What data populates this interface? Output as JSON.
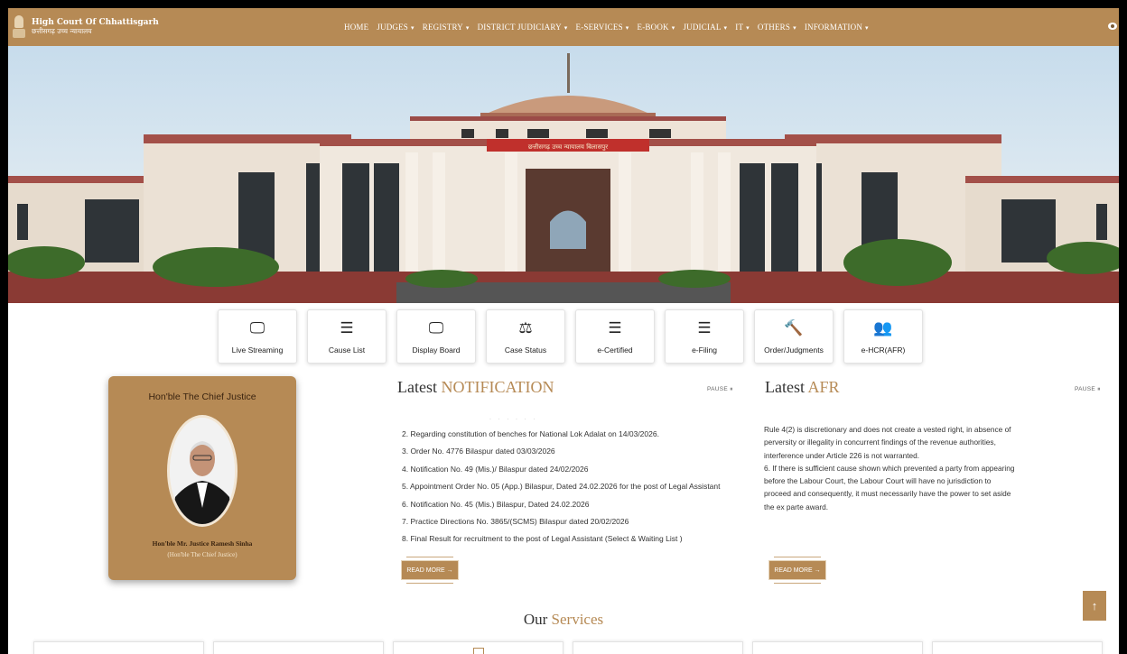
{
  "header": {
    "brand_title": "High Court Of Chhattisgarh",
    "brand_sub": "छत्तीसगढ़ उच्च न्यायालय",
    "nav": [
      {
        "label": "HOME",
        "caret": false
      },
      {
        "label": "JUDGES",
        "caret": true
      },
      {
        "label": "REGISTRY",
        "caret": true
      },
      {
        "label": "DISTRICT JUDICIARY",
        "caret": true
      },
      {
        "label": "E-SERVICES",
        "caret": true
      },
      {
        "label": "E-BOOK",
        "caret": true
      },
      {
        "label": "JUDICIAL",
        "caret": true
      },
      {
        "label": "IT",
        "caret": true
      },
      {
        "label": "OTHERS",
        "caret": true
      },
      {
        "label": "INFORMATION",
        "caret": true
      }
    ],
    "caret": "▾"
  },
  "hero": {
    "banner_text": "छत्तीसगढ़ उच्च न्यायालय बिलासपुर"
  },
  "quick_links": [
    {
      "label": "Live Streaming",
      "icon": "monitor-icon",
      "glyph": "🖵"
    },
    {
      "label": "Cause List",
      "icon": "list-icon",
      "glyph": "☰"
    },
    {
      "label": "Display Board",
      "icon": "monitor-icon",
      "glyph": "🖵"
    },
    {
      "label": "Case Status",
      "icon": "scale-icon",
      "glyph": "⚖"
    },
    {
      "label": "e-Certified",
      "icon": "list-icon",
      "glyph": "☰"
    },
    {
      "label": "e-Filing",
      "icon": "list-icon",
      "glyph": "☰"
    },
    {
      "label": "Order/Judgments",
      "icon": "gavel-icon",
      "glyph": "🔨"
    },
    {
      "label": "e-HCR(AFR)",
      "icon": "users-icon",
      "glyph": "👥"
    }
  ],
  "chief_justice": {
    "title": "Hon'ble The Chief Justice",
    "name": "Hon'ble Mr. Justice Ramesh Sinha",
    "role": "(Hon'ble The Chief Justice)"
  },
  "notification": {
    "title_plain": "Latest",
    "title_accent": "NOTIFICATION",
    "pause": "PAUSE ⏸",
    "items": [
      "2. Regarding constitution of benches for National Lok Adalat on 14/03/2026.",
      "3. Order No. 4776 Bilaspur dated 03/03/2026",
      "4. Notification No. 49 (Mis.)/ Bilaspur dated 24/02/2026",
      "5. Appointment Order No. 05 (App.) Bilaspur, Dated 24.02.2026 for the post of Legal Assistant",
      "6. Notification No. 45 (Mis.) Bilaspur, Dated 24.02.2026",
      "7. Practice Directions No. 3865/(SCMS) Bilaspur dated 20/02/2026",
      "8. Final Result for recruitment to the post of Legal Assistant (Select & Waiting List )"
    ],
    "read_more": "READ MORE →"
  },
  "afr": {
    "title_plain": "Latest",
    "title_accent": "AFR",
    "pause": "PAUSE ⏸",
    "text": "Rule 4(2) is discretionary and does not create a vested right, in absence of perversity or illegality in concurrent findings of the revenue authorities, interference under Article 226 is not warranted.",
    "text2": "6. If there is sufficient cause shown which prevented a party from appearing before the Labour Court, the Labour Court will have no jurisdiction to proceed and consequently, it must necessarily have the power to set aside the ex parte award.",
    "read_more": "READ MORE →"
  },
  "services": {
    "title_plain": "Our",
    "title_accent": "Services"
  },
  "scroll_top": "↑",
  "colors": {
    "accent": "#b68a55",
    "dark": "#3b2410"
  }
}
